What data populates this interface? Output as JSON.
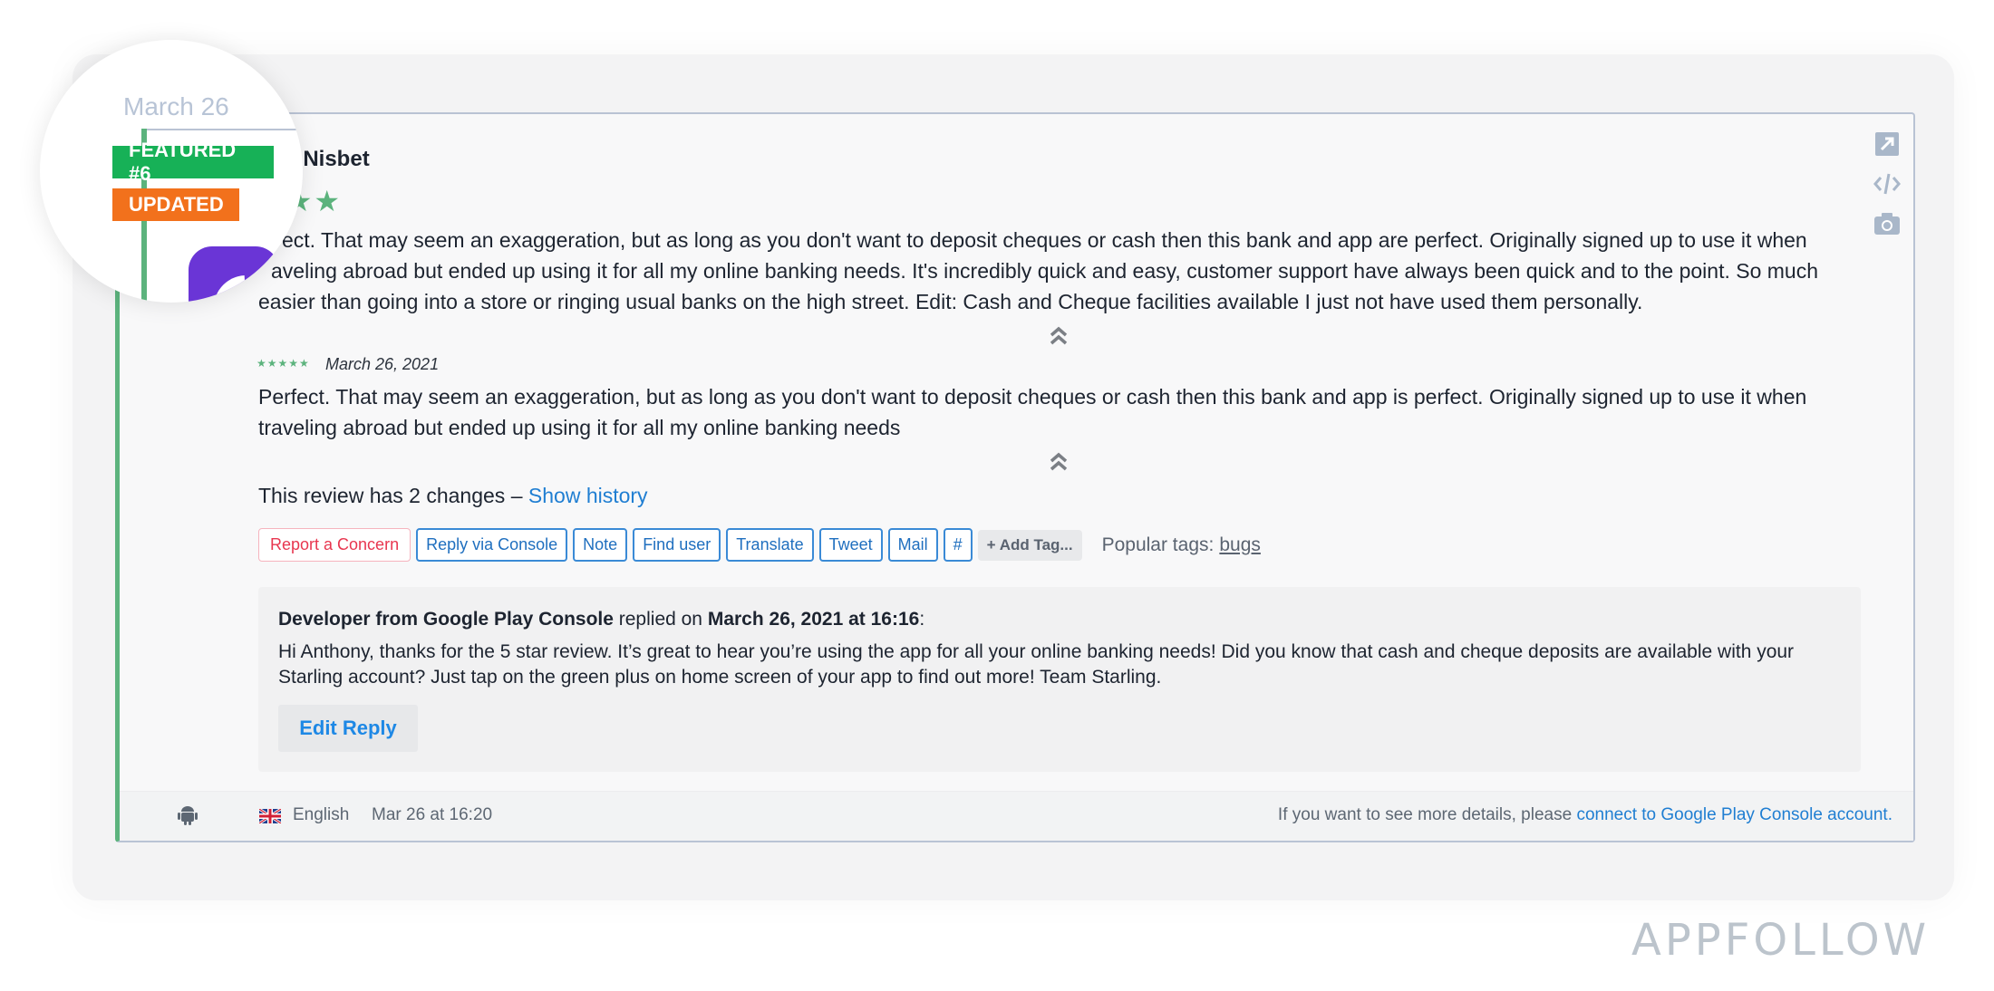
{
  "timeline": {
    "date_label": "March 26"
  },
  "badges": {
    "featured": "FEATURED #6",
    "updated": "UPDATED"
  },
  "review": {
    "author_visible": "ony Nisbet",
    "author_full": "Anthony Nisbet",
    "rating": 5,
    "stars_visible": "★★★",
    "text": "ect. That may seem an exaggeration, but as long as you don't want to deposit cheques or cash then this bank and app are perfect. Originally signed up to use it when traveling abroad but ended up using it for all my online banking needs. It's incredibly quick and easy, customer support have always been quick and to the point. So much easier than going into a store or ringing usual banks on the high street. Edit: Cash and Cheque facilities available I just not have used them personally.",
    "text_line1": "ect. That may seem an exaggeration, but as long as you don't want to deposit cheques or cash then this bank and app are perfect. Originally signed up to use it when",
    "text_line2": "aveling abroad but ended up using it for all my online banking needs. It's incredibly quick and easy, customer support have always been quick and to the point. So much",
    "text_line3": "easier than going into a store or ringing usual banks on the high street. Edit: Cash and Cheque facilities available I just not have used them personally."
  },
  "history": {
    "stars": "★★★★★",
    "rating": 5,
    "date": "March 26, 2021",
    "text": "Perfect. That may seem an exaggeration, but as long as you don't want to deposit cheques or cash then this bank and app is perfect. Originally signed up to use it when traveling abroad but ended up using it for all my online banking needs",
    "changes_text": "This review has 2 changes – ",
    "show_history": "Show history"
  },
  "actions": {
    "report": "Report a Concern",
    "reply_console": "Reply via Console",
    "note": "Note",
    "find_user": "Find user",
    "translate": "Translate",
    "tweet": "Tweet",
    "mail": "Mail",
    "hash": "#",
    "add_tag": "+ Add Tag...",
    "popular_label": "Popular tags:",
    "popular_tags": [
      "bugs"
    ]
  },
  "reply": {
    "author": "Developer from Google Play Console",
    "replied_on": " replied on ",
    "date": "March 26, 2021 at 16:16",
    "colon": ":",
    "body": "Hi Anthony, thanks for the 5 star review. It’s great to hear you’re using the app for all your online banking needs! Did you know that cash and cheque deposits are available with your Starling account? Just tap on the green plus on home screen of your app to find out more! Team Starling.",
    "edit_button": "Edit Reply"
  },
  "footer": {
    "platform_icon": "android-icon",
    "flag_icon": "uk-flag-icon",
    "language": "English",
    "timestamp": "Mar 26 at 16:20",
    "details_text": "If you want to see more details, please ",
    "details_link": "connect to Google Play Console account."
  },
  "side_icons": [
    "open-external-icon",
    "embed-code-icon",
    "screenshot-camera-icon"
  ],
  "brand": "APPFOLLOW",
  "colors": {
    "accent_green": "#5cb37d",
    "featured_badge": "#17b157",
    "updated_badge": "#f2711c",
    "link_blue": "#1f7ed2",
    "concern_red": "#e8364f",
    "app_icon_purple": "#6a35d6"
  }
}
